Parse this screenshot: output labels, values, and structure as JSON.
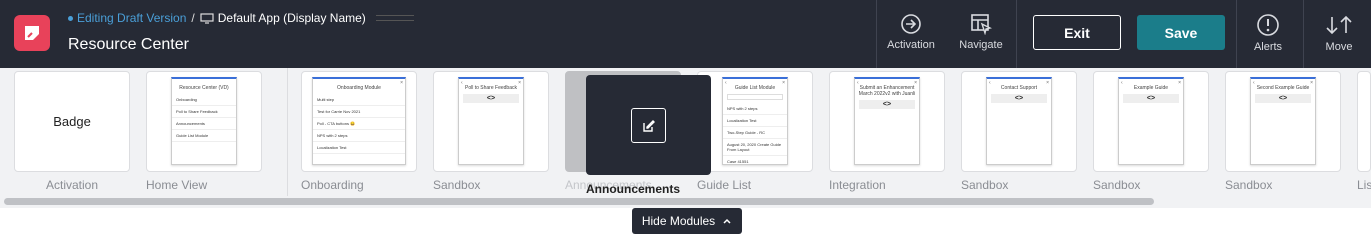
{
  "header": {
    "breadcrumb_status": "Editing Draft Version",
    "breadcrumb_separator": "/",
    "breadcrumb_app": "Default App (Display Name)",
    "title": "Resource Center",
    "logo_icon": "pendo-logo-icon",
    "brand_color": "#e8425a"
  },
  "toolbar": {
    "activation_label": "Activation",
    "navigate_label": "Navigate",
    "exit_label": "Exit",
    "save_label": "Save",
    "alerts_label": "Alerts",
    "move_label": "Move",
    "save_color": "#1b7d8a"
  },
  "modules": [
    {
      "label": "Activation",
      "card_text": "Badge"
    },
    {
      "label": "Home View",
      "preview": {
        "title": "Resource Center (VD)",
        "items": [
          "Onboarding",
          "Poll to Share Feedback",
          "Announcements",
          "Guide List Module"
        ]
      }
    },
    {
      "label": "Onboarding",
      "preview": {
        "title": "Onboarding Module",
        "items": [
          "Multi step",
          "Test for Carrie Nov 2021",
          "Poll - CTA buttons 😀",
          "NPS with 2 steps",
          "Localization Test"
        ]
      }
    },
    {
      "label": "Sandbox",
      "preview": {
        "title": "Poll to Share Feedback",
        "code": "<>"
      }
    },
    {
      "label": "Announcements"
    },
    {
      "label": "Guide List",
      "preview": {
        "title": "Guide List Module",
        "items": [
          "NPS with 2 steps",
          "Localization Test",
          "Two-Step Guide - RC",
          "August 20, 2020 Create Guide From Layout",
          "Case 41551"
        ]
      }
    },
    {
      "label": "Integration",
      "preview": {
        "title": "Submit an Enhancement March 2022v2 with Juanli",
        "code": "<>"
      }
    },
    {
      "label": "Sandbox",
      "preview": {
        "title": "Contact Support",
        "code": "<>"
      }
    },
    {
      "label": "Sandbox",
      "preview": {
        "title": "Example Guide",
        "code": "<>"
      }
    },
    {
      "label": "Sandbox",
      "preview": {
        "title": "Second Example Guide",
        "code": "<>"
      }
    },
    {
      "label": "Lis"
    }
  ],
  "tooltip": {
    "label": "Announcements",
    "icon": "edit-icon"
  },
  "footer": {
    "hide_modules_label": "Hide Modules",
    "chevron_icon": "chevron-up-icon"
  }
}
